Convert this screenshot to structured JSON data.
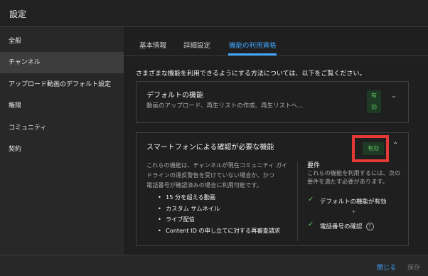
{
  "window": {
    "title": "設定"
  },
  "sidebar": {
    "items": [
      {
        "label": "全般"
      },
      {
        "label": "チャンネル"
      },
      {
        "label": "アップロード動画のデフォルト設定"
      },
      {
        "label": "権限"
      },
      {
        "label": "コミュニティ"
      },
      {
        "label": "契約"
      }
    ],
    "active_index": 1
  },
  "tabs": {
    "items": [
      {
        "label": "基本情報"
      },
      {
        "label": "詳細設定"
      },
      {
        "label": "機能の利用資格"
      }
    ],
    "active_index": 2
  },
  "main": {
    "intro": "さまざまな機能を利用できるようにする方法については、以下をご覧ください。",
    "card1": {
      "title": "デフォルトの機能",
      "description": "動画のアップロード、再生リストの作成、再生リストへ...",
      "badge": "有効"
    },
    "card2": {
      "title": "スマートフォンによる確認が必要な機能",
      "badge": "有効",
      "body_lines": [
        "これらの機能は、チャンネルが現在コミュニティ ガイ",
        "ドラインの違反警告を受けていない場合か、かつ",
        "電話番号が確認済みの場合に利用可能です。"
      ],
      "features": [
        "15 分を超える動画",
        "カスタム サムネイル",
        "ライブ配信",
        "Content ID の申し立てに対する再審査請求"
      ],
      "requirements": {
        "title": "要件",
        "desc_lines": [
          "これらの機能を利用するには、次の",
          "要件を満たす必要があります。"
        ],
        "items": [
          "デフォルトの機能が有効",
          "電話番号の確認"
        ],
        "separator": "+"
      }
    }
  },
  "footer": {
    "close": "閉じる",
    "save": "保存"
  },
  "colors": {
    "accent": "#3ea6ff",
    "success": "#5fbf63",
    "highlight": "#e53935"
  }
}
